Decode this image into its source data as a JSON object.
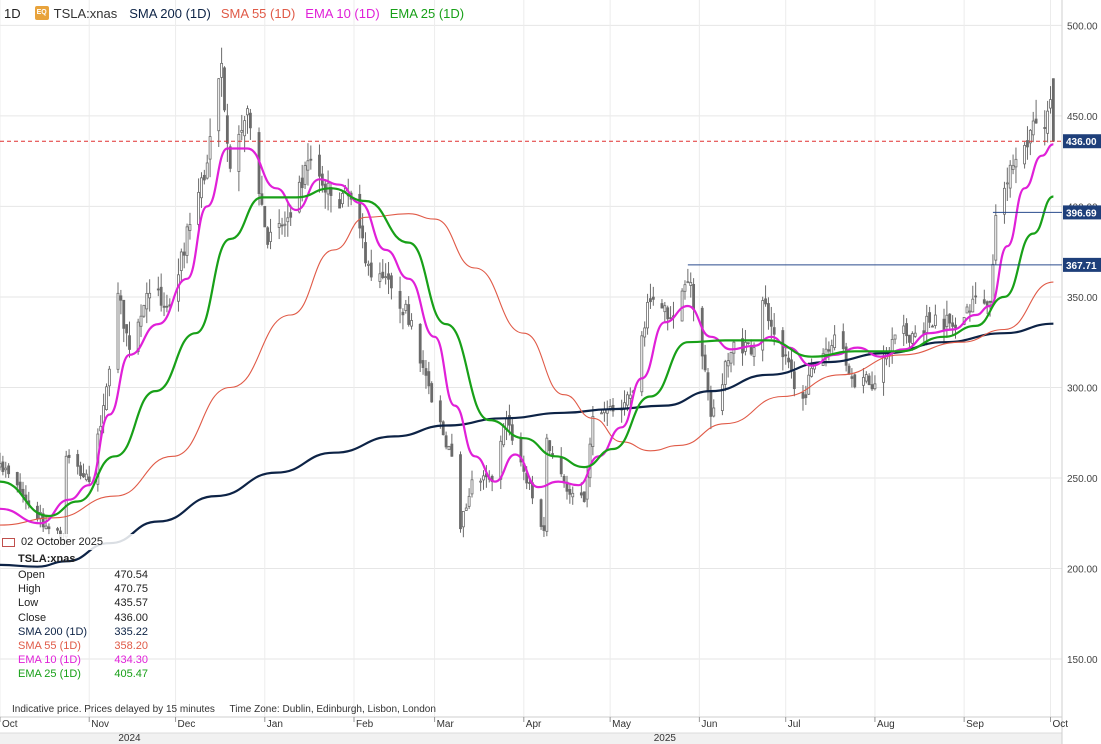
{
  "header": {
    "timeframe": "1D",
    "badge": "EQ",
    "symbol": "TSLA:xnas",
    "indicators": [
      {
        "label": "SMA 200 (1D)",
        "color": "#0d2346"
      },
      {
        "label": "SMA 55 (1D)",
        "color": "#e05a47"
      },
      {
        "label": "EMA 10 (1D)",
        "color": "#e020d8"
      },
      {
        "label": "EMA 25 (1D)",
        "color": "#18a018"
      }
    ]
  },
  "info_panel": {
    "date": "02 October 2025",
    "symbol": "TSLA:xnas",
    "rows": [
      {
        "label": "Open",
        "value": "470.54",
        "color": "#222222"
      },
      {
        "label": "High",
        "value": "470.75",
        "color": "#222222"
      },
      {
        "label": "Low",
        "value": "435.57",
        "color": "#222222"
      },
      {
        "label": "Close",
        "value": "436.00",
        "color": "#222222"
      },
      {
        "label": "SMA 200 (1D)",
        "value": "335.22",
        "color": "#0d2346"
      },
      {
        "label": "SMA 55 (1D)",
        "value": "358.20",
        "color": "#e05a47"
      },
      {
        "label": "EMA 10 (1D)",
        "value": "434.30",
        "color": "#e020d8"
      },
      {
        "label": "EMA 25 (1D)",
        "value": "405.47",
        "color": "#18a018"
      }
    ]
  },
  "footnote": {
    "delay_text": "Indicative price. Prices delayed by 15 minutes",
    "timezone_text": "Time Zone: Dublin, Edinburgh, Lisbon, London"
  },
  "colors": {
    "candle": "#6b6b6b",
    "grid": "#e6e6e6",
    "price_tag": "#1e3f7a",
    "last_price_line": "#e03030",
    "level_line": "#2a4b8d"
  },
  "chart_data": {
    "type": "candlestick",
    "title": "",
    "xlabel": "",
    "ylabel": "",
    "ylim": [
      118,
      514
    ],
    "y_ticks": [
      150,
      200,
      250,
      300,
      350,
      400,
      450,
      500
    ],
    "y_tick_labels": [
      "150.00",
      "200.00",
      "250.00",
      "300.00",
      "350.00",
      "400.00",
      "450.00",
      "500.00"
    ],
    "x_tick_labels": [
      "Oct",
      "Nov",
      "Dec",
      "Jan",
      "Feb",
      "Mar",
      "Apr",
      "May",
      "Jun",
      "Jul",
      "Aug",
      "Sep",
      "Oct"
    ],
    "x_tick_dates": [
      "2024-10-01",
      "2024-11-01",
      "2024-12-01",
      "2025-01-01",
      "2025-02-01",
      "2025-03-01",
      "2025-04-01",
      "2025-05-01",
      "2025-06-01",
      "2025-07-01",
      "2025-08-01",
      "2025-09-01",
      "2025-10-01"
    ],
    "year_labels": [
      {
        "label": "2024",
        "date": "2024-11-15"
      },
      {
        "label": "2025",
        "date": "2025-05-20"
      }
    ],
    "x_range": [
      "2024-10-01",
      "2025-10-05"
    ],
    "last_price": {
      "value": 436.0,
      "label": "436.00"
    },
    "price_levels": [
      {
        "value": 396.69,
        "label": "396.69",
        "start": "2025-09-11"
      },
      {
        "value": 367.71,
        "label": "367.71",
        "start": "2025-05-28"
      }
    ],
    "ohlc_anchors": [
      {
        "date": "2024-10-01",
        "close": 258
      },
      {
        "date": "2024-10-10",
        "close": 238
      },
      {
        "date": "2024-10-18",
        "close": 222
      },
      {
        "date": "2024-10-23",
        "close": 216
      },
      {
        "date": "2024-10-24",
        "close": 262
      },
      {
        "date": "2024-11-01",
        "close": 248
      },
      {
        "date": "2024-11-06",
        "close": 290
      },
      {
        "date": "2024-11-11",
        "close": 352
      },
      {
        "date": "2024-11-15",
        "close": 321
      },
      {
        "date": "2024-11-22",
        "close": 352
      },
      {
        "date": "2024-11-29",
        "close": 345
      },
      {
        "date": "2024-12-06",
        "close": 390
      },
      {
        "date": "2024-12-12",
        "close": 424
      },
      {
        "date": "2024-12-17",
        "close": 479
      },
      {
        "date": "2024-12-20",
        "close": 421
      },
      {
        "date": "2024-12-26",
        "close": 454
      },
      {
        "date": "2025-01-02",
        "close": 379
      },
      {
        "date": "2025-01-10",
        "close": 394
      },
      {
        "date": "2025-01-17",
        "close": 426
      },
      {
        "date": "2025-01-24",
        "close": 406
      },
      {
        "date": "2025-01-31",
        "close": 404
      },
      {
        "date": "2025-02-07",
        "close": 361
      },
      {
        "date": "2025-02-14",
        "close": 355
      },
      {
        "date": "2025-02-21",
        "close": 337
      },
      {
        "date": "2025-02-28",
        "close": 292
      },
      {
        "date": "2025-03-07",
        "close": 262
      },
      {
        "date": "2025-03-10",
        "close": 222
      },
      {
        "date": "2025-03-14",
        "close": 249
      },
      {
        "date": "2025-03-21",
        "close": 248
      },
      {
        "date": "2025-03-26",
        "close": 283
      },
      {
        "date": "2025-04-04",
        "close": 239
      },
      {
        "date": "2025-04-08",
        "close": 221
      },
      {
        "date": "2025-04-09",
        "close": 272
      },
      {
        "date": "2025-04-17",
        "close": 241
      },
      {
        "date": "2025-04-22",
        "close": 237
      },
      {
        "date": "2025-04-25",
        "close": 284
      },
      {
        "date": "2025-05-02",
        "close": 287
      },
      {
        "date": "2025-05-09",
        "close": 298
      },
      {
        "date": "2025-05-14",
        "close": 347
      },
      {
        "date": "2025-05-23",
        "close": 339
      },
      {
        "date": "2025-05-29",
        "close": 358
      },
      {
        "date": "2025-06-05",
        "close": 284
      },
      {
        "date": "2025-06-13",
        "close": 325
      },
      {
        "date": "2025-06-20",
        "close": 322
      },
      {
        "date": "2025-06-23",
        "close": 348
      },
      {
        "date": "2025-06-30",
        "close": 317
      },
      {
        "date": "2025-07-07",
        "close": 294
      },
      {
        "date": "2025-07-11",
        "close": 313
      },
      {
        "date": "2025-07-18",
        "close": 329
      },
      {
        "date": "2025-07-24",
        "close": 305
      },
      {
        "date": "2025-08-01",
        "close": 302
      },
      {
        "date": "2025-08-08",
        "close": 329
      },
      {
        "date": "2025-08-15",
        "close": 330
      },
      {
        "date": "2025-08-22",
        "close": 340
      },
      {
        "date": "2025-08-29",
        "close": 333
      },
      {
        "date": "2025-09-05",
        "close": 350
      },
      {
        "date": "2025-09-10",
        "close": 347
      },
      {
        "date": "2025-09-11",
        "close": 368
      },
      {
        "date": "2025-09-12",
        "close": 395
      },
      {
        "date": "2025-09-15",
        "close": 410
      },
      {
        "date": "2025-09-19",
        "close": 426
      },
      {
        "date": "2025-09-24",
        "close": 442
      },
      {
        "date": "2025-09-29",
        "close": 443
      },
      {
        "date": "2025-10-01",
        "close": 459
      },
      {
        "date": "2025-10-02",
        "open": 470.54,
        "high": 470.75,
        "low": 435.57,
        "close": 436.0
      }
    ],
    "series": [
      {
        "name": "SMA 200 (1D)",
        "color": "#0d2346",
        "width": 2.2,
        "points": [
          [
            "2024-10-01",
            202
          ],
          [
            "2024-10-14",
            201
          ],
          [
            "2024-10-24",
            204
          ],
          [
            "2024-11-08",
            214
          ],
          [
            "2024-11-25",
            226
          ],
          [
            "2024-12-15",
            240
          ],
          [
            "2025-01-05",
            253
          ],
          [
            "2025-01-25",
            264
          ],
          [
            "2025-02-15",
            273
          ],
          [
            "2025-03-05",
            279
          ],
          [
            "2025-03-25",
            283
          ],
          [
            "2025-04-15",
            286
          ],
          [
            "2025-05-01",
            288
          ],
          [
            "2025-05-20",
            290
          ],
          [
            "2025-06-05",
            298
          ],
          [
            "2025-06-25",
            307
          ],
          [
            "2025-07-15",
            314
          ],
          [
            "2025-08-05",
            319
          ],
          [
            "2025-08-25",
            325
          ],
          [
            "2025-09-15",
            330
          ],
          [
            "2025-10-02",
            335.2
          ]
        ]
      },
      {
        "name": "SMA 55 (1D)",
        "color": "#e05a47",
        "width": 1.1,
        "points": [
          [
            "2024-10-01",
            224
          ],
          [
            "2024-10-20",
            228
          ],
          [
            "2024-11-10",
            240
          ],
          [
            "2024-11-30",
            262
          ],
          [
            "2024-12-20",
            300
          ],
          [
            "2025-01-10",
            340
          ],
          [
            "2025-01-25",
            376
          ],
          [
            "2025-02-05",
            394
          ],
          [
            "2025-02-20",
            396
          ],
          [
            "2025-03-01",
            393
          ],
          [
            "2025-03-15",
            366
          ],
          [
            "2025-04-01",
            330
          ],
          [
            "2025-04-15",
            296
          ],
          [
            "2025-04-25",
            283
          ],
          [
            "2025-05-05",
            270
          ],
          [
            "2025-05-15",
            265
          ],
          [
            "2025-05-25",
            268
          ],
          [
            "2025-06-10",
            280
          ],
          [
            "2025-06-30",
            295
          ],
          [
            "2025-07-20",
            307
          ],
          [
            "2025-08-10",
            318
          ],
          [
            "2025-08-31",
            325
          ],
          [
            "2025-09-15",
            332
          ],
          [
            "2025-10-02",
            358.2
          ]
        ]
      },
      {
        "name": "EMA 10 (1D)",
        "color": "#e020d8",
        "width": 2.2,
        "points": [
          [
            "2024-10-01",
            233
          ],
          [
            "2024-10-15",
            225
          ],
          [
            "2024-10-25",
            238
          ],
          [
            "2024-11-01",
            246
          ],
          [
            "2024-11-08",
            285
          ],
          [
            "2024-11-15",
            318
          ],
          [
            "2024-11-25",
            335
          ],
          [
            "2024-12-05",
            360
          ],
          [
            "2024-12-12",
            400
          ],
          [
            "2024-12-19",
            432
          ],
          [
            "2024-12-26",
            432
          ],
          [
            "2025-01-05",
            410
          ],
          [
            "2025-01-12",
            398
          ],
          [
            "2025-01-20",
            415
          ],
          [
            "2025-01-27",
            412
          ],
          [
            "2025-02-03",
            402
          ],
          [
            "2025-02-12",
            376
          ],
          [
            "2025-02-20",
            360
          ],
          [
            "2025-03-01",
            328
          ],
          [
            "2025-03-08",
            290
          ],
          [
            "2025-03-15",
            262
          ],
          [
            "2025-03-22",
            248
          ],
          [
            "2025-03-29",
            263
          ],
          [
            "2025-04-06",
            245
          ],
          [
            "2025-04-13",
            248
          ],
          [
            "2025-04-20",
            246
          ],
          [
            "2025-04-27",
            262
          ],
          [
            "2025-05-05",
            278
          ],
          [
            "2025-05-12",
            305
          ],
          [
            "2025-05-20",
            336
          ],
          [
            "2025-05-28",
            345
          ],
          [
            "2025-06-05",
            328
          ],
          [
            "2025-06-12",
            321
          ],
          [
            "2025-06-20",
            323
          ],
          [
            "2025-06-26",
            328
          ],
          [
            "2025-07-02",
            322
          ],
          [
            "2025-07-10",
            312
          ],
          [
            "2025-07-18",
            318
          ],
          [
            "2025-07-26",
            322
          ],
          [
            "2025-08-03",
            317
          ],
          [
            "2025-08-11",
            321
          ],
          [
            "2025-08-20",
            330
          ],
          [
            "2025-08-28",
            332
          ],
          [
            "2025-09-05",
            340
          ],
          [
            "2025-09-10",
            345
          ],
          [
            "2025-09-16",
            378
          ],
          [
            "2025-09-22",
            410
          ],
          [
            "2025-09-28",
            428
          ],
          [
            "2025-10-02",
            434.3
          ]
        ]
      },
      {
        "name": "EMA 25 (1D)",
        "color": "#18a018",
        "width": 2.2,
        "points": [
          [
            "2024-10-01",
            248
          ],
          [
            "2024-10-18",
            229
          ],
          [
            "2024-10-28",
            237
          ],
          [
            "2024-11-10",
            262
          ],
          [
            "2024-11-24",
            298
          ],
          [
            "2024-12-08",
            330
          ],
          [
            "2024-12-20",
            382
          ],
          [
            "2024-12-31",
            405
          ],
          [
            "2025-01-12",
            405
          ],
          [
            "2025-01-24",
            410
          ],
          [
            "2025-02-05",
            403
          ],
          [
            "2025-02-20",
            380
          ],
          [
            "2025-03-05",
            335
          ],
          [
            "2025-03-20",
            282
          ],
          [
            "2025-04-01",
            272
          ],
          [
            "2025-04-12",
            262
          ],
          [
            "2025-04-22",
            256
          ],
          [
            "2025-05-02",
            266
          ],
          [
            "2025-05-15",
            295
          ],
          [
            "2025-05-28",
            325
          ],
          [
            "2025-06-10",
            326
          ],
          [
            "2025-06-25",
            326
          ],
          [
            "2025-07-10",
            317
          ],
          [
            "2025-07-25",
            320
          ],
          [
            "2025-08-10",
            320
          ],
          [
            "2025-08-25",
            328
          ],
          [
            "2025-09-05",
            334
          ],
          [
            "2025-09-15",
            350
          ],
          [
            "2025-09-25",
            385
          ],
          [
            "2025-10-02",
            405.5
          ]
        ]
      }
    ]
  }
}
